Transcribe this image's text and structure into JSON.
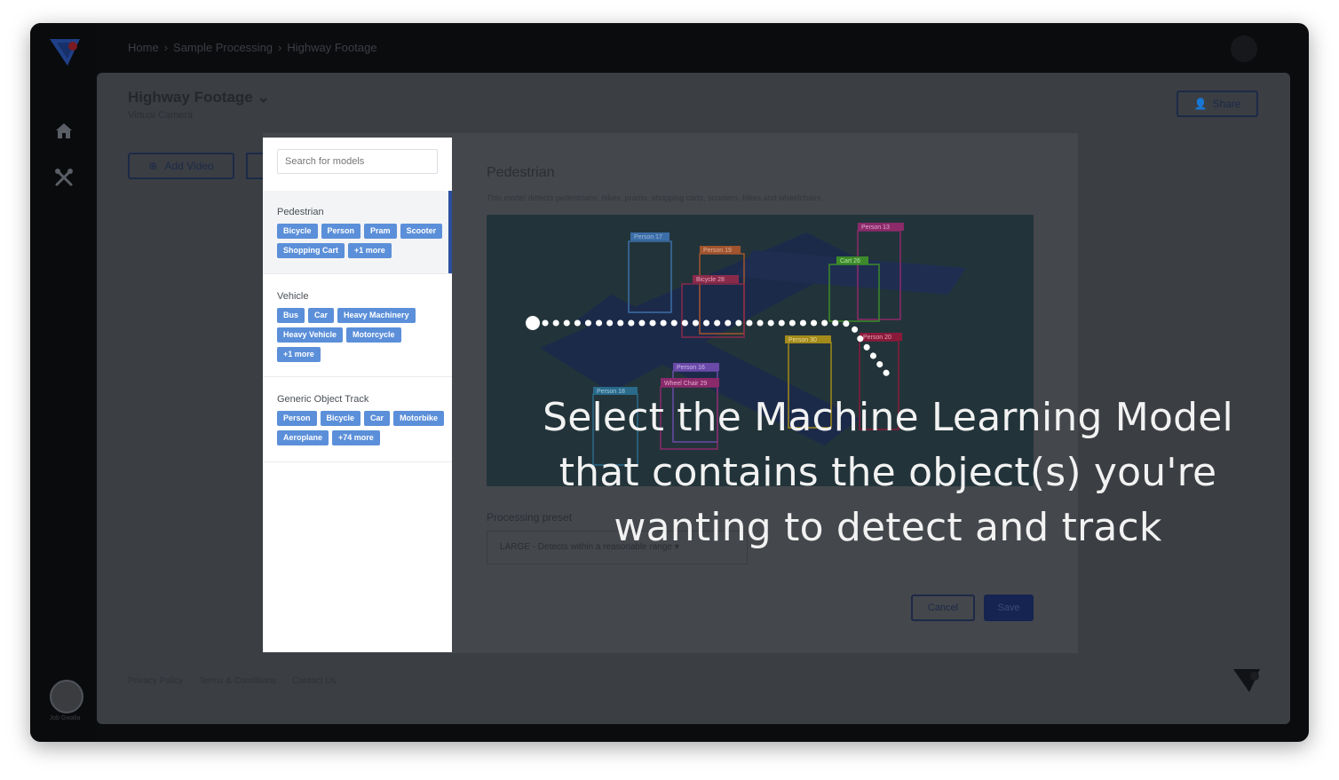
{
  "breadcrumb": [
    "Home",
    "Sample Processing",
    "Highway Footage"
  ],
  "project": {
    "title": "Highway Footage",
    "subtitle": "Virtual Camera",
    "share_label": "Share",
    "add_video_label": "Add Video"
  },
  "nav": {
    "avatar_label": "Job Gwalia"
  },
  "footer": {
    "links": [
      "Privacy Policy",
      "Terms & Conditions",
      "Contact Us"
    ]
  },
  "model_search": {
    "placeholder": "Search for models"
  },
  "models": [
    {
      "name": "Pedestrian",
      "selected": true,
      "tags": [
        "Bicycle",
        "Person",
        "Pram",
        "Scooter",
        "Shopping Cart",
        "+1 more"
      ]
    },
    {
      "name": "Vehicle",
      "selected": false,
      "tags": [
        "Bus",
        "Car",
        "Heavy Machinery",
        "Heavy Vehicle",
        "Motorcycle",
        "+1 more"
      ]
    },
    {
      "name": "Generic Object Track",
      "selected": false,
      "tags": [
        "Person",
        "Bicycle",
        "Car",
        "Motorbike",
        "Aeroplane",
        "+74 more"
      ]
    }
  ],
  "detail": {
    "title": "Pedestrian",
    "description": "This model detects pedestrians, bikes, prams, shopping carts, scooters, bikes and wheelchairs",
    "preview_labels": [
      "Person 17",
      "Person 19",
      "Person 13",
      "Bicycle 28",
      "Cart 26",
      "Person 30",
      "Person 20",
      "Person 16",
      "Wheel Chair 29",
      "Person 18"
    ],
    "preset_label": "Processing preset",
    "preset_value": "LARGE - Detects within a reasonable range",
    "cancel_label": "Cancel",
    "save_label": "Save"
  },
  "tooltip": {
    "lines": [
      "Select the Machine Learning Model",
      "that contains the object(s) you're",
      "wanting to detect and track"
    ]
  },
  "colors": {
    "accent": "#2b4f9f",
    "tag": "#5b8fd9",
    "tooltip_text": "#f2f2f2"
  }
}
